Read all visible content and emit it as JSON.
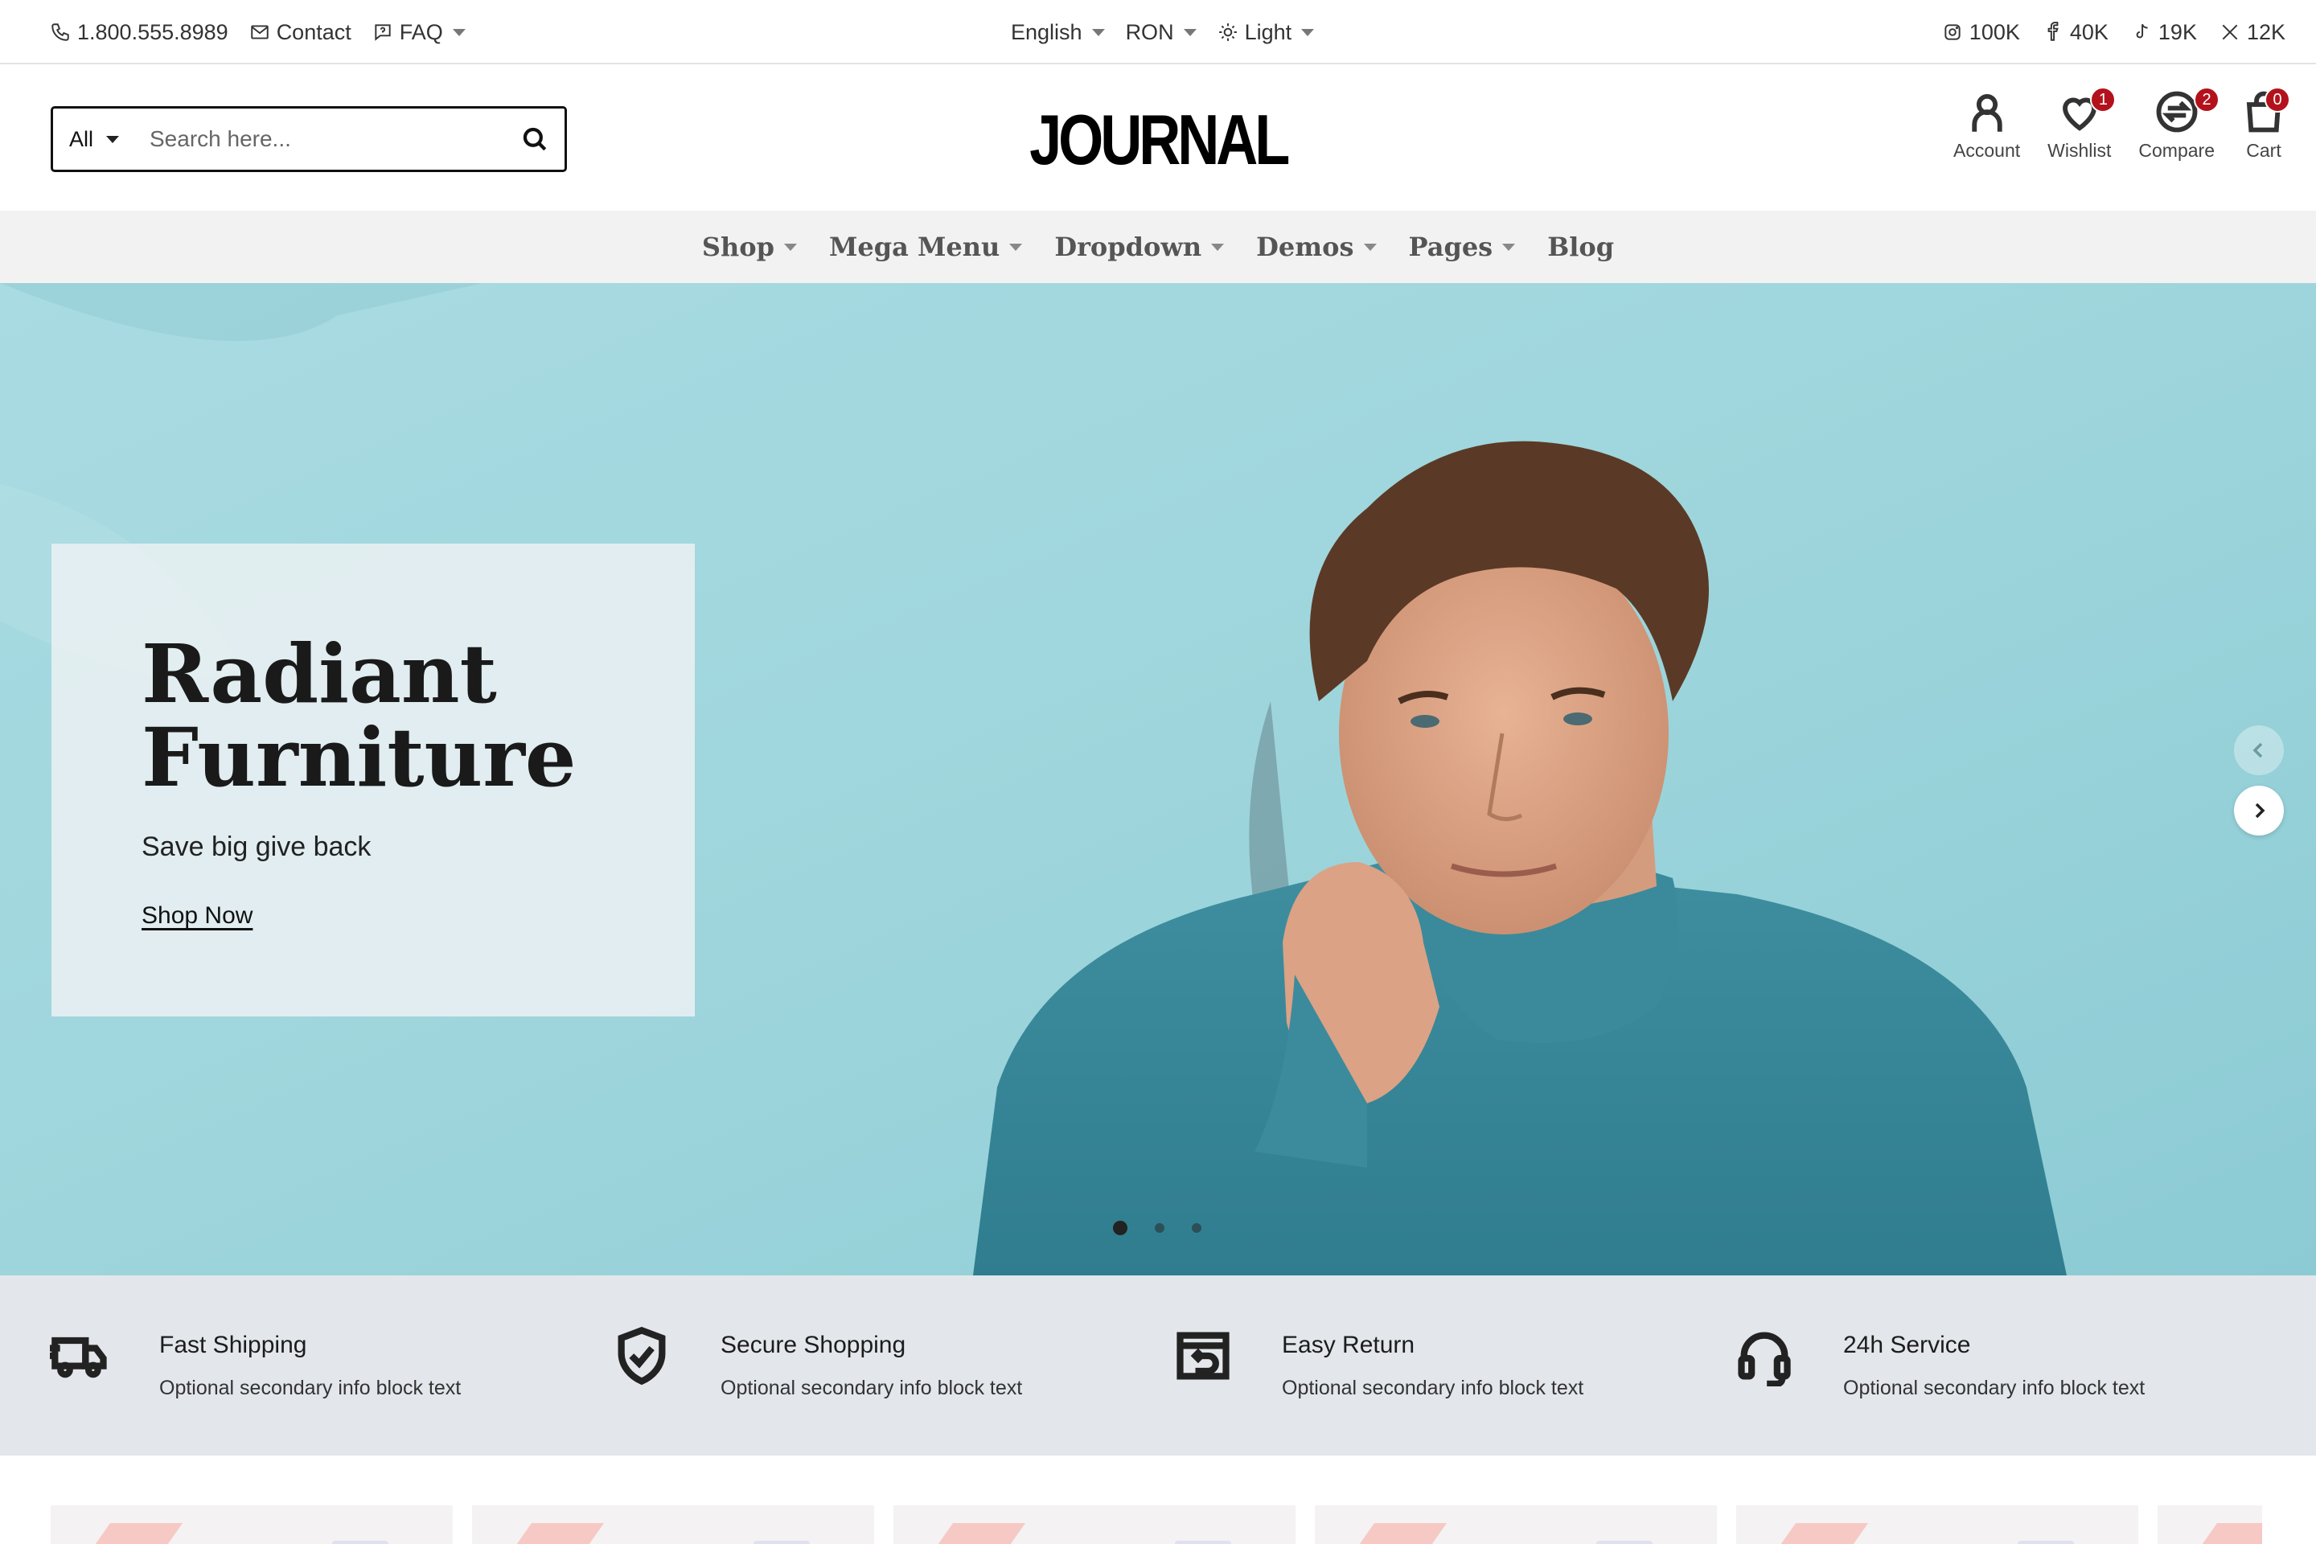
{
  "topbar": {
    "phone": "1.800.555.8989",
    "contact": "Contact",
    "faq": "FAQ",
    "language": "English",
    "currency": "RON",
    "theme": "Light",
    "social": [
      {
        "network": "instagram",
        "count": "100K"
      },
      {
        "network": "facebook",
        "count": "40K"
      },
      {
        "network": "tiktok",
        "count": "19K"
      },
      {
        "network": "x",
        "count": "12K"
      }
    ]
  },
  "header": {
    "search": {
      "category": "All",
      "placeholder": "Search here..."
    },
    "logo": "JOURNAL",
    "account": "Account",
    "wishlist": {
      "label": "Wishlist",
      "count": "1"
    },
    "compare": {
      "label": "Compare",
      "count": "2"
    },
    "cart": {
      "label": "Cart",
      "count": "0"
    }
  },
  "nav": {
    "items": [
      {
        "label": "Shop"
      },
      {
        "label": "Mega Menu"
      },
      {
        "label": "Dropdown"
      },
      {
        "label": "Demos"
      },
      {
        "label": "Pages"
      },
      {
        "label": "Blog"
      }
    ]
  },
  "hero": {
    "title": "Radiant Furniture",
    "subtitle": "Save big give back",
    "cta": "Shop Now",
    "slide_count": 3,
    "active_slide": 1
  },
  "info_blocks": [
    {
      "icon": "truck-icon",
      "title": "Fast Shipping",
      "text": "Optional secondary info block text"
    },
    {
      "icon": "shield-check-icon",
      "title": "Secure Shopping",
      "text": "Optional secondary info block text"
    },
    {
      "icon": "return-box-icon",
      "title": "Easy Return",
      "text": "Optional secondary info block text"
    },
    {
      "icon": "headset-icon",
      "title": "24h Service",
      "text": "Optional secondary info block text"
    }
  ],
  "colors": {
    "badge": "#b3121c",
    "hero_bg": "#9bd3db",
    "info_bg": "#e3e6eb",
    "nav_bg": "#f2f2f2"
  }
}
